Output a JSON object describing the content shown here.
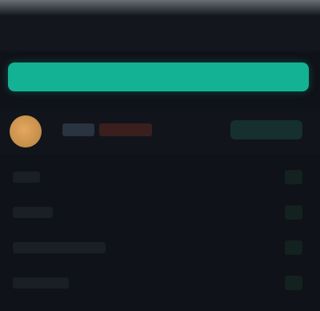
{
  "header": {
    "title": ""
  },
  "primary_action": {
    "label": ""
  },
  "user": {
    "name": "",
    "badge": "",
    "action_label": ""
  },
  "list": {
    "items": [
      {
        "label": "",
        "value": ""
      },
      {
        "label": "",
        "value": ""
      },
      {
        "label": "",
        "value": ""
      },
      {
        "label": "",
        "value": ""
      }
    ]
  },
  "colors": {
    "background": "#0f1218",
    "accent": "#14b294",
    "avatar": "#d69a52",
    "badge": "#3a1f1e"
  }
}
